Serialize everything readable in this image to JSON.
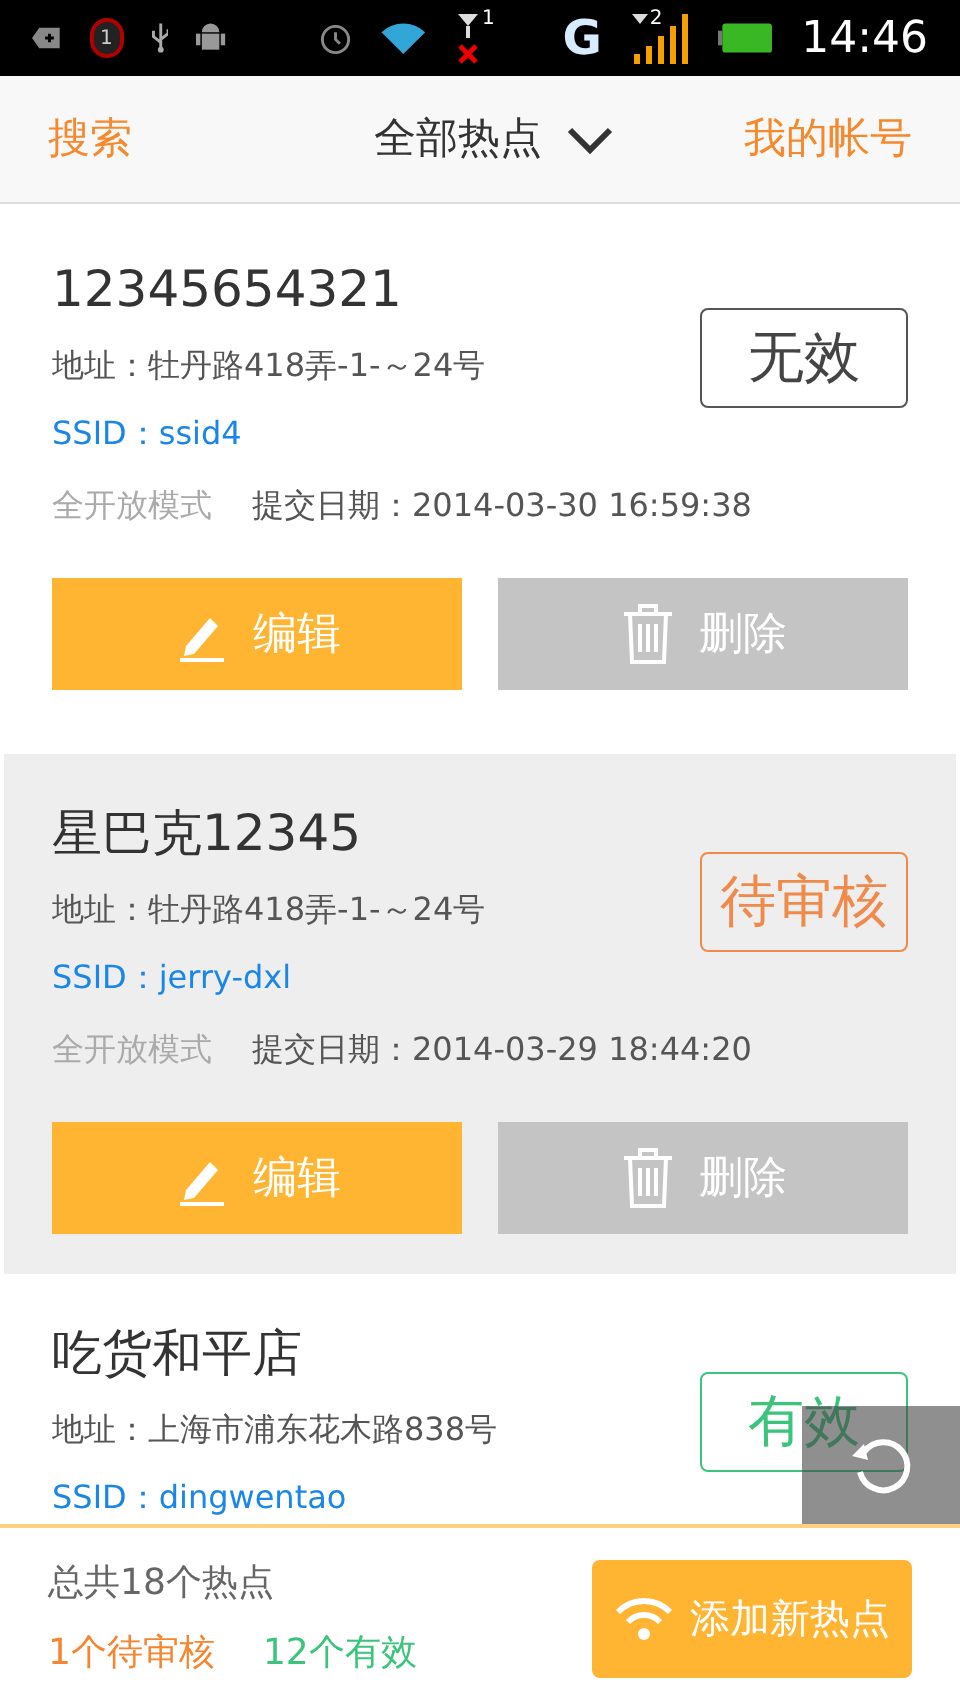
{
  "status_bar": {
    "alarm_count": "1",
    "sim1_label": "1",
    "network": "G",
    "sim2_label": "2",
    "time": "14:46"
  },
  "header": {
    "left": "搜索",
    "title": "全部热点",
    "right": "我的帐号"
  },
  "hotspots": [
    {
      "name": "12345654321",
      "address": "地址：牡丹路418弄-1-～24号",
      "ssid": "SSID：ssid4",
      "mode": "全开放模式",
      "date": "提交日期：2014-03-30 16:59:38",
      "status": {
        "kind": "invalid",
        "label": "无效"
      },
      "selected": false,
      "buttons": [
        {
          "kind": "edit",
          "label": "编辑"
        },
        {
          "kind": "delete",
          "label": "删除"
        }
      ]
    },
    {
      "name": "星巴克12345",
      "address": "地址：牡丹路418弄-1-～24号",
      "ssid": "SSID：jerry-dxl",
      "mode": "全开放模式",
      "date": "提交日期：2014-03-29 18:44:20",
      "status": {
        "kind": "pending",
        "label": "待审核"
      },
      "selected": true,
      "buttons": [
        {
          "kind": "edit",
          "label": "编辑"
        },
        {
          "kind": "delete",
          "label": "删除"
        }
      ]
    },
    {
      "name": "吃货和平店",
      "address": "地址：上海市浦东花木路838号",
      "ssid": "SSID：dingwentao",
      "status": {
        "kind": "valid",
        "label": "有效"
      },
      "selected": false
    }
  ],
  "footer": {
    "total": "总共18个热点",
    "pending": "1个待审核",
    "valid": "12个有效",
    "add_button": "添加新热点"
  }
}
